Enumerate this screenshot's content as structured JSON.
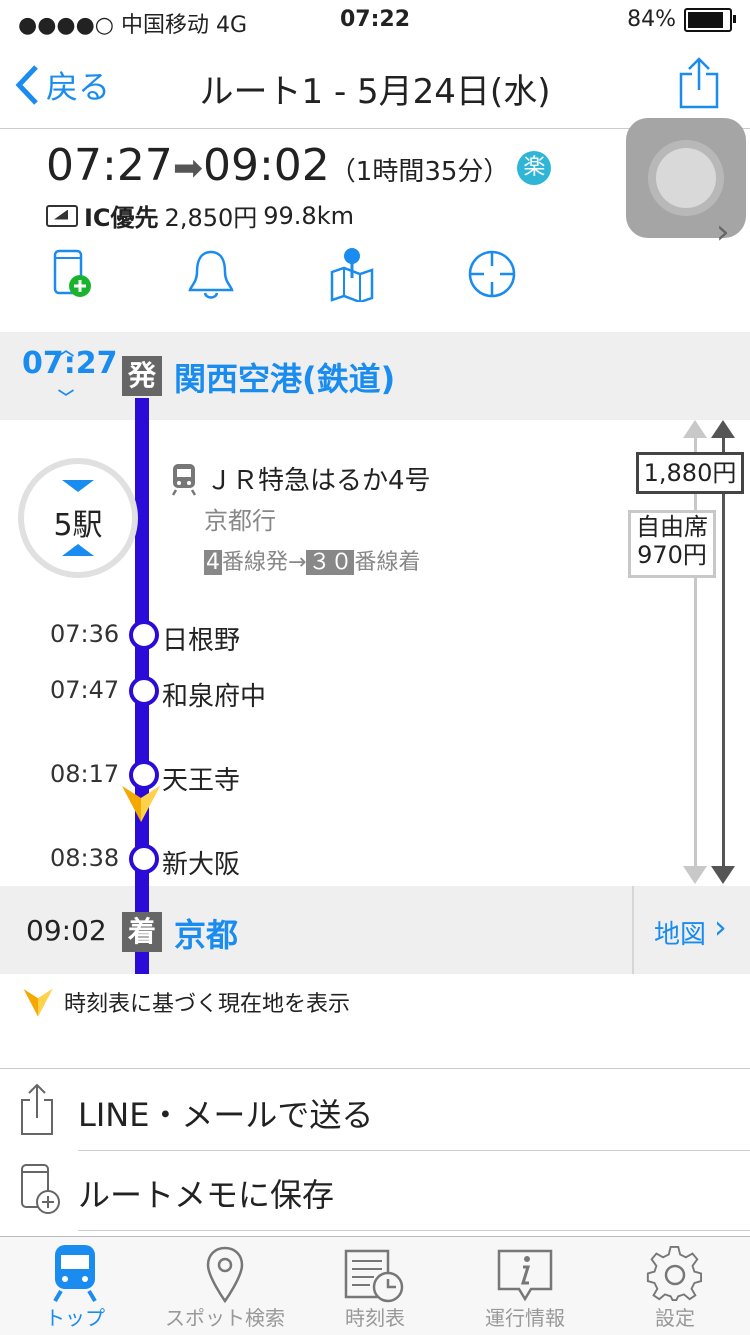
{
  "status": {
    "carrier": "●●●●○ 中国移动   4G",
    "time": "07:22",
    "battery": "84%"
  },
  "nav": {
    "back": "戻る",
    "title": "ルート1 - 5月24日(水)"
  },
  "summary": {
    "dep_time": "07:27",
    "arr_time": "09:02",
    "duration": "（1時間35分）",
    "raku": "楽",
    "ic_label": "IC優先",
    "price": "2,850円",
    "distance": "99.8km"
  },
  "departure": {
    "time": "07:27",
    "tag": "発",
    "station": "関西空港(鉄道)"
  },
  "train": {
    "stations_count": "5駅",
    "name": "ＪＲ特急はるか4号",
    "dest": "京都行",
    "dep_track": "4",
    "dep_suffix": "番線発→",
    "arr_track": "３０",
    "arr_suffix": "番線着"
  },
  "fares": {
    "express": "1,880円",
    "seat_type": "自由席",
    "seat_price": "970円"
  },
  "stops": [
    {
      "time": "07:36",
      "name": "日根野"
    },
    {
      "time": "07:47",
      "name": "和泉府中"
    },
    {
      "time": "08:17",
      "name": "天王寺"
    },
    {
      "time": "08:38",
      "name": "新大阪"
    }
  ],
  "arrival": {
    "time": "09:02",
    "tag": "着",
    "station": "京都",
    "map": "地図"
  },
  "legend": "時刻表に基づく現在地を表示",
  "actions": {
    "send": "LINE・メールで送る",
    "save": "ルートメモに保存"
  },
  "tabs": {
    "top": "トップ",
    "spot": "スポット検索",
    "timetable": "時刻表",
    "info": "運行情報",
    "settings": "設定"
  },
  "colors": {
    "accent": "#1a8cf0",
    "line": "#2b0bd8",
    "position": "#f5a800"
  }
}
